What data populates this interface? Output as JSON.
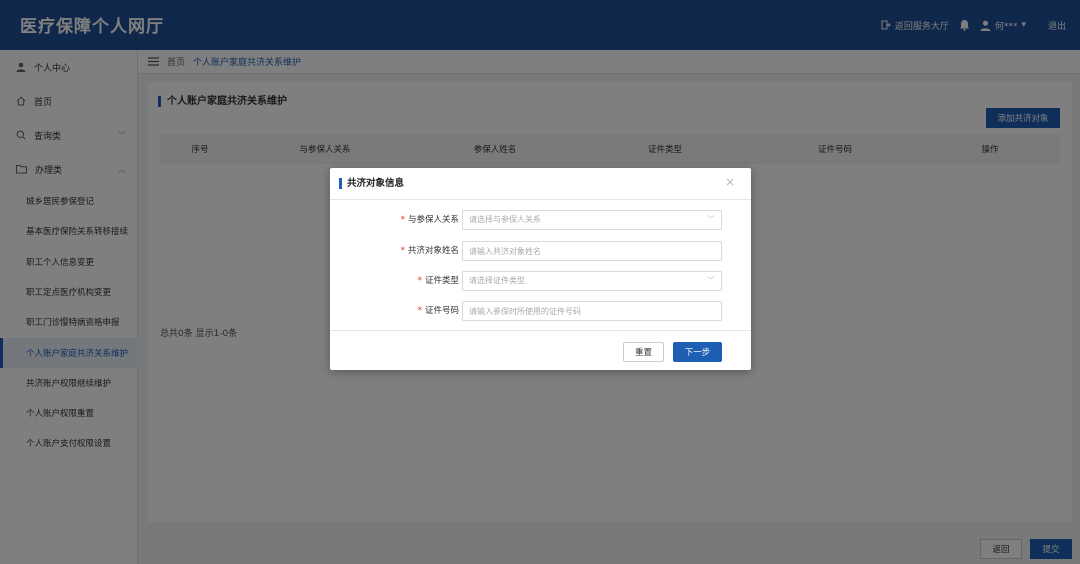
{
  "header": {
    "logo": "医疗保障个人网厅",
    "service_hall": "返回服务大厅",
    "username": "何***",
    "logout": "退出"
  },
  "sidebar": {
    "items": [
      {
        "label": "个人中心",
        "icon": "user-icon"
      },
      {
        "label": "首页",
        "icon": "home-icon"
      },
      {
        "label": "查询类",
        "icon": "search-icon"
      },
      {
        "label": "办理类",
        "icon": "folder-icon"
      }
    ],
    "subitems": [
      "城乡居民参保登记",
      "基本医疗保险关系转移接续",
      "职工个人信息变更",
      "职工定点医疗机构变更",
      "职工门诊慢特病资格申报",
      "个人账户家庭共济关系维护",
      "共济账户权限继续维护",
      "个人账户权限重置",
      "个人账户支付权限设置"
    ]
  },
  "breadcrumb": {
    "home": "首页",
    "current": "个人账户家庭共济关系维护"
  },
  "panel": {
    "title": "个人账户家庭共济关系维护",
    "add_button": "添加共济对象",
    "columns": [
      "序号",
      "与参保人关系",
      "参保人姓名",
      "证件类型",
      "证件号码",
      "操作"
    ],
    "pager": "总共0条 显示1-0条"
  },
  "footer": {
    "prev": "返回",
    "submit": "提交"
  },
  "modal": {
    "title": "共济对象信息",
    "fields": [
      {
        "label": "与参保人关系",
        "placeholder": "请选择与参保人关系"
      },
      {
        "label": "共济对象姓名",
        "placeholder": "请输入共济对象姓名"
      },
      {
        "label": "证件类型",
        "placeholder": "请选择证件类型"
      },
      {
        "label": "证件号码",
        "placeholder": "请输入参保时所使用的证件号码"
      }
    ],
    "reset": "重置",
    "next": "下一步"
  },
  "colors": {
    "header": "#1e4f97",
    "primary": "#1e5fb4",
    "required": "#e0322c"
  }
}
